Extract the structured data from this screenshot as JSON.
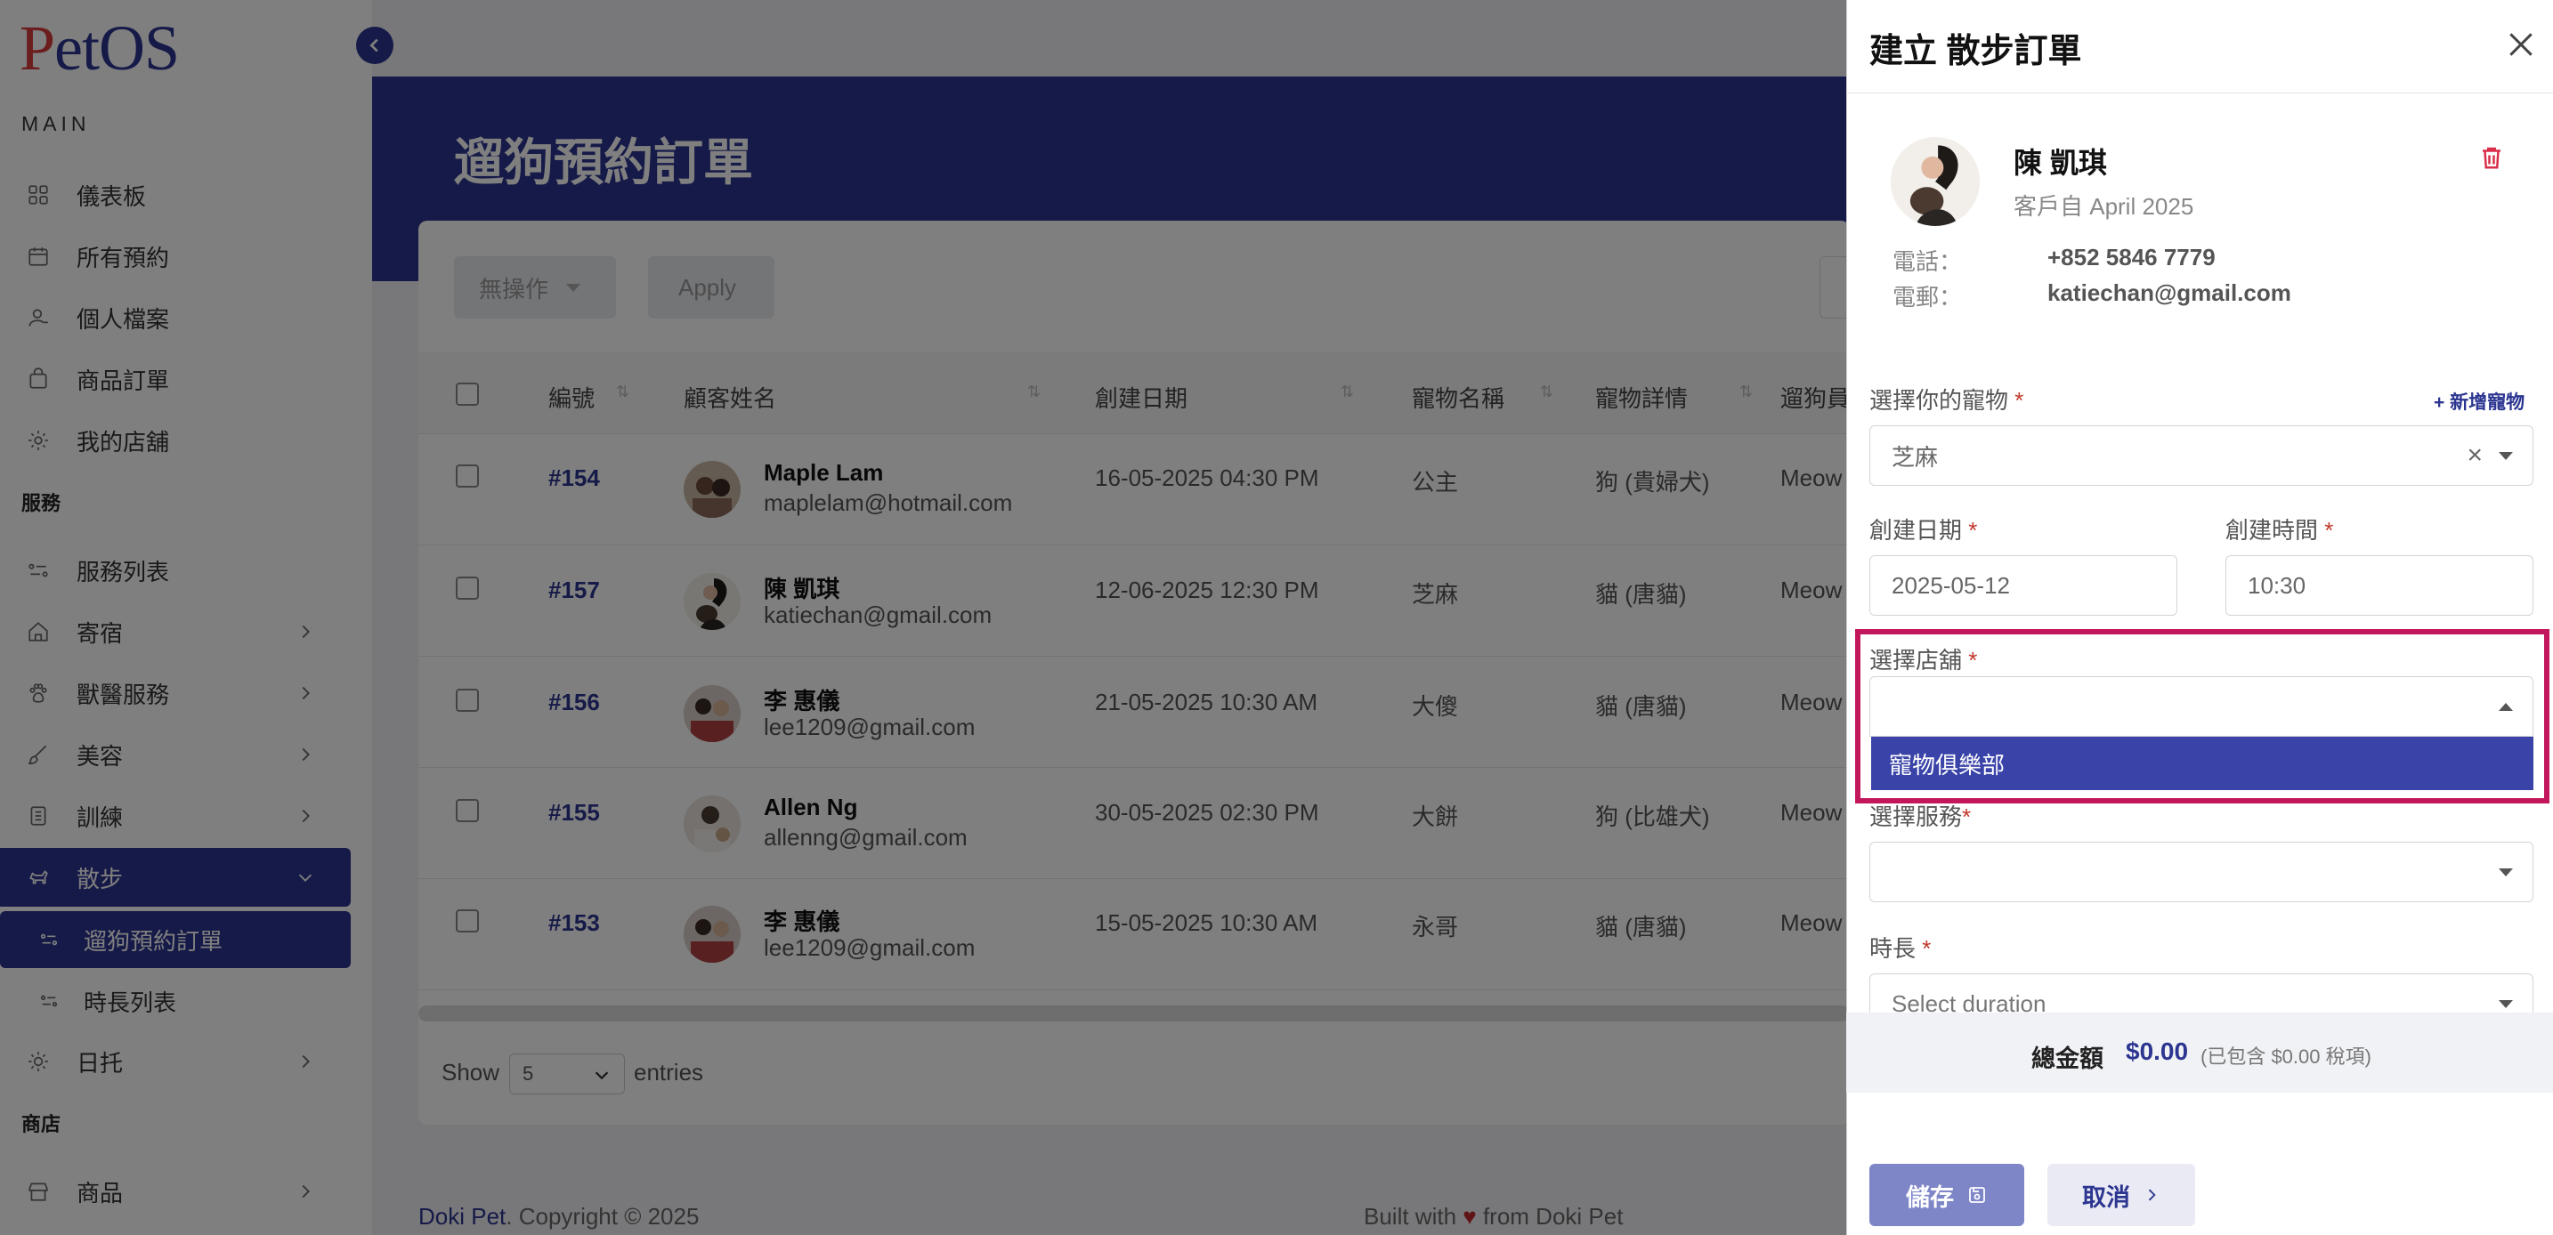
{
  "brand": {
    "logo_p": "P",
    "logo_rest": "etOS"
  },
  "sidebar": {
    "section_main": "MAIN",
    "section_services": "服務",
    "section_shop": "商店",
    "items": {
      "dashboard": "儀表板",
      "bookings": "所有預約",
      "profile": "個人檔案",
      "orders": "商品訂單",
      "store": "我的店舖",
      "service_list": "服務列表",
      "boarding": "寄宿",
      "vet": "獸醫服務",
      "grooming": "美容",
      "training": "訓練",
      "walking": "散步",
      "walking_orders": "遛狗預約訂單",
      "duration_list": "時長列表",
      "daycare": "日托",
      "products": "商品"
    }
  },
  "page": {
    "title": "遛狗預約訂單"
  },
  "toolbar": {
    "bulk_action": "無操作",
    "apply": "Apply"
  },
  "table": {
    "headers": {
      "id": "編號",
      "customer": "顧客姓名",
      "created": "創建日期",
      "pet_name": "寵物名稱",
      "pet_detail": "寵物詳情",
      "walker": "遛狗員"
    },
    "rows": [
      {
        "id": "#154",
        "name": "Maple Lam",
        "email": "maplelam@hotmail.com",
        "date": "16-05-2025 04:30 PM",
        "pet": "公主",
        "detail": "狗 (貴婦犬)",
        "walker": "Meow"
      },
      {
        "id": "#157",
        "name": "陳 凱琪",
        "email": "katiechan@gmail.com",
        "date": "12-06-2025 12:30 PM",
        "pet": "芝麻",
        "detail": "貓 (唐貓)",
        "walker": "Meow"
      },
      {
        "id": "#156",
        "name": "李 惠儀",
        "email": "lee1209@gmail.com",
        "date": "21-05-2025 10:30 AM",
        "pet": "大傻",
        "detail": "貓 (唐貓)",
        "walker": "Meow"
      },
      {
        "id": "#155",
        "name": "Allen Ng",
        "email": "allenng@gmail.com",
        "date": "30-05-2025 02:30 PM",
        "pet": "大餅",
        "detail": "狗 (比雄犬)",
        "walker": "Meow"
      },
      {
        "id": "#153",
        "name": "李 惠儀",
        "email": "lee1209@gmail.com",
        "date": "15-05-2025 10:30 AM",
        "pet": "永哥",
        "detail": "貓 (唐貓)",
        "walker": "Meow"
      }
    ]
  },
  "pagination": {
    "show": "Show",
    "entries_value": "5",
    "entries": "entries"
  },
  "footer": {
    "brand": "Doki Pet",
    "copyright": ". Copyright © 2025",
    "built_with": "Built with",
    "heart": "♥",
    "from": "from Doki Pet"
  },
  "drawer": {
    "title": "建立 散步訂單",
    "customer": {
      "name": "陳 凱琪",
      "since": "客戶自 April 2025",
      "phone_label": "電話：",
      "phone": "+852 5846 7779",
      "email_label": "電郵：",
      "email": "katiechan@gmail.com"
    },
    "pet_label": "選擇你的寵物",
    "add_pet": "+ 新增寵物",
    "pet_value": "芝麻",
    "clear": "×",
    "date_label": "創建日期",
    "date_value": "2025-05-12",
    "time_label": "創建時間",
    "time_value": "10:30",
    "store_label": "選擇店舖",
    "store_option": "寵物俱樂部",
    "service_label": "選擇服務",
    "duration_label": "時長",
    "duration_placeholder": "Select duration",
    "required": "*",
    "total_label": "總金額",
    "total_amount": "$0.00",
    "total_tax": "(已包含 $0.00 稅項)",
    "save": "儲存",
    "cancel": "取消"
  },
  "colors": {
    "primary": "#2c3590",
    "highlight": "#c2185b",
    "danger": "#d92f4a"
  }
}
